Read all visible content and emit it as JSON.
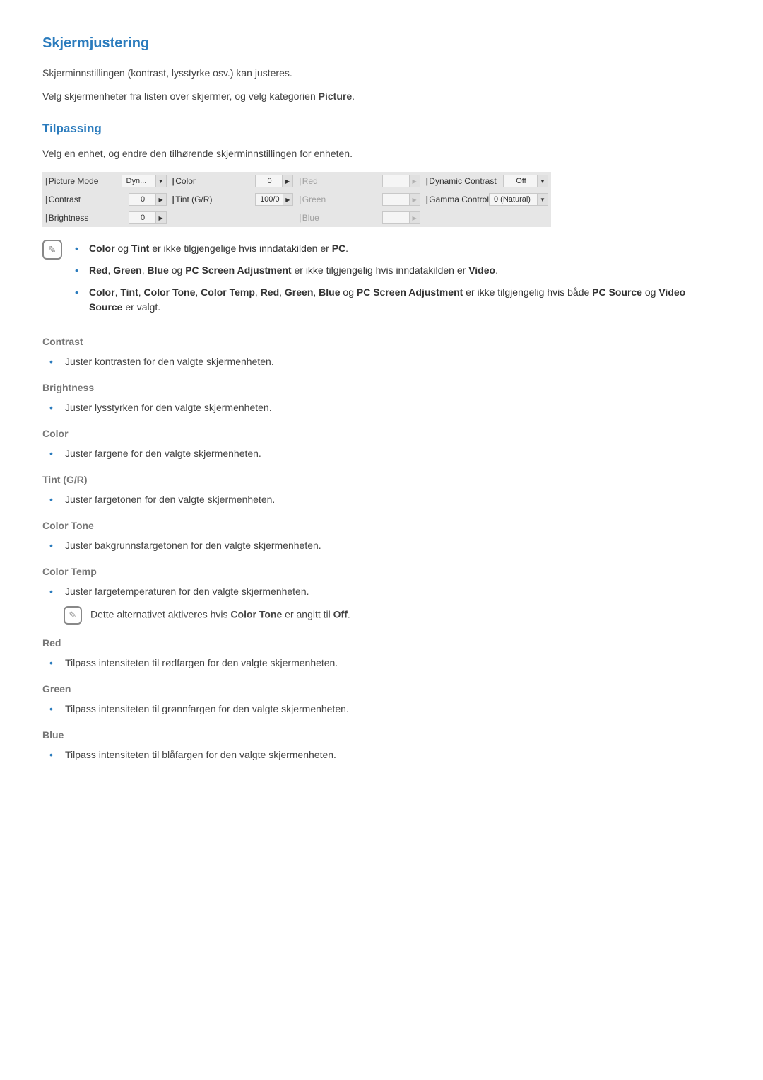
{
  "title": "Skjermjustering",
  "intro1_pre": "Skjerminnstillingen (kontrast, lysstyrke osv.) kan justeres.",
  "intro2_pre": "Velg skjermenheter fra listen over skjermer, og velg kategorien ",
  "intro2_bold": "Picture",
  "intro2_post": ".",
  "tilpassing_title": "Tilpassing",
  "tilpassing_intro": "Velg en enhet, og endre den tilhørende skjerminnstillingen for enheten.",
  "panel": {
    "pictureMode": {
      "label": "Picture Mode",
      "value": "Dyn..."
    },
    "contrast": {
      "label": "Contrast",
      "value": "0"
    },
    "brightness": {
      "label": "Brightness",
      "value": "0"
    },
    "color": {
      "label": "Color",
      "value": "0"
    },
    "tint": {
      "label": "Tint (G/R)",
      "value": "100/0"
    },
    "red": {
      "label": "Red"
    },
    "green": {
      "label": "Green"
    },
    "blue": {
      "label": "Blue"
    },
    "dynContrast": {
      "label": "Dynamic Contrast",
      "value": "Off"
    },
    "gamma": {
      "label": "Gamma Control",
      "value": "0 (Natural)"
    }
  },
  "notes": {
    "n1": {
      "b1": "Color",
      "t1": " og ",
      "b2": "Tint",
      "t2": " er ikke tilgjengelige hvis inndatakilden er ",
      "b3": "PC",
      "t3": "."
    },
    "n2": {
      "b1": "Red",
      "c1": ", ",
      "b2": "Green",
      "c2": ", ",
      "b3": "Blue",
      "t1": " og ",
      "b4": "PC Screen Adjustment",
      "t2": " er ikke tilgjengelig hvis inndatakilden er ",
      "b5": "Video",
      "t3": "."
    },
    "n3": {
      "b1": "Color",
      "c1": ", ",
      "b2": "Tint",
      "c2": ", ",
      "b3": "Color Tone",
      "c3": ", ",
      "b4": "Color Temp",
      "c4": ", ",
      "b5": "Red",
      "c5": ", ",
      "b6": "Green",
      "c6": ", ",
      "b7": "Blue",
      "t1": " og ",
      "b8": "PC Screen Adjustment",
      "t2": " er ikke tilgjengelig hvis både ",
      "b9": "PC Source",
      "t3": " og ",
      "b10": "Video Source",
      "t4": " er valgt."
    }
  },
  "settings": {
    "contrast": {
      "h": "Contrast",
      "d": "Juster kontrasten for den valgte skjermenheten."
    },
    "brightness": {
      "h": "Brightness",
      "d": "Juster lysstyrken for den valgte skjermenheten."
    },
    "color": {
      "h": "Color",
      "d": "Juster fargene for den valgte skjermenheten."
    },
    "tint": {
      "h": "Tint (G/R)",
      "d": "Juster fargetonen for den valgte skjermenheten."
    },
    "colorTone": {
      "h": "Color Tone",
      "d": "Juster bakgrunnsfargetonen for den valgte skjermenheten."
    },
    "colorTemp": {
      "h": "Color Temp",
      "d": "Juster fargetemperaturen for den valgte skjermenheten.",
      "note_pre": "Dette alternativet aktiveres hvis ",
      "note_b1": "Color Tone",
      "note_mid": " er angitt til ",
      "note_b2": "Off",
      "note_post": "."
    },
    "red": {
      "h": "Red",
      "d": "Tilpass intensiteten til rødfargen for den valgte skjermenheten."
    },
    "green": {
      "h": "Green",
      "d": "Tilpass intensiteten til grønnfargen for den valgte skjermenheten."
    },
    "blue": {
      "h": "Blue",
      "d": "Tilpass intensiteten til blåfargen for den valgte skjermenheten."
    }
  }
}
